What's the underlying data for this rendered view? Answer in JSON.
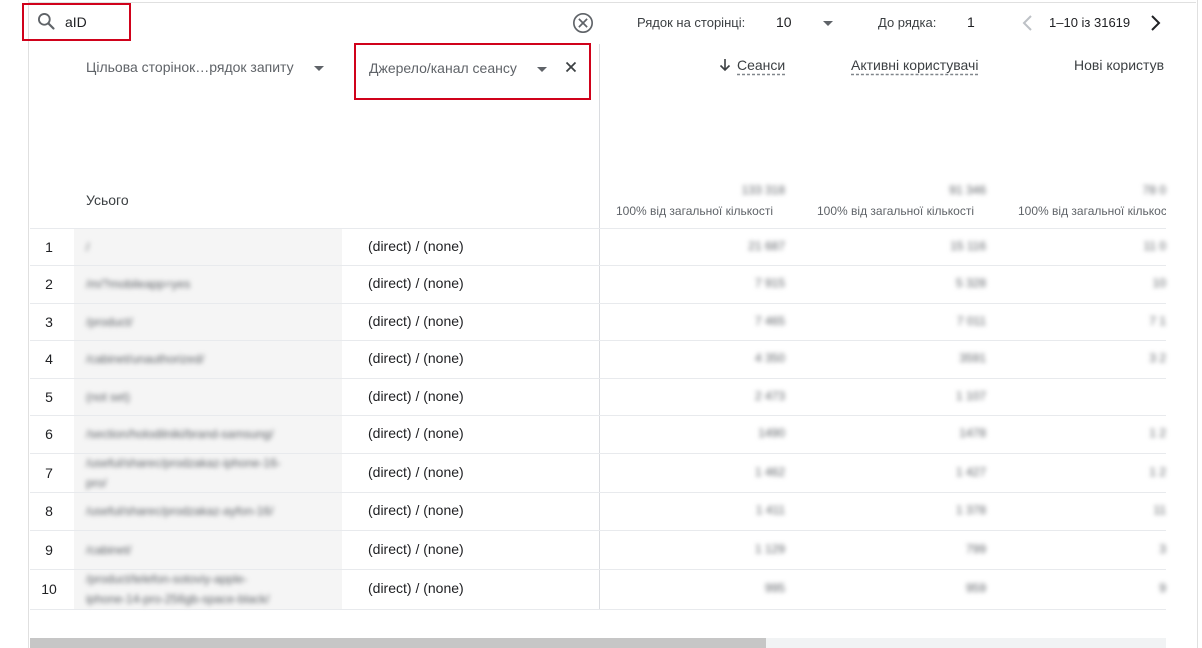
{
  "search": {
    "value": "aID"
  },
  "pagination": {
    "rows_per_page_label": "Рядок на сторінці:",
    "rows_per_page_value": "10",
    "goto_label": "До рядка:",
    "goto_value": "1",
    "range_text": "1–10 із 31619"
  },
  "table": {
    "dimension1_header": "Цільова сторінок…рядок запиту",
    "dimension2_header": "Джерело/канал сеансу",
    "metrics": [
      {
        "label": "Сеанси",
        "total": "133 318",
        "pct": "100% від загальної кількості"
      },
      {
        "label": "Активні користувачі",
        "total": "91 346",
        "pct": "100% від загальної кількості"
      },
      {
        "label": "Нові користув",
        "total": "78 0",
        "pct": "100% від загальної кількос"
      }
    ],
    "totals_label": "Усього",
    "rows": [
      {
        "num": "1",
        "page": "/",
        "page2": "",
        "source": "(direct) / (none)",
        "m1": "21 687",
        "m2": "15 116",
        "m3": "11 0"
      },
      {
        "num": "2",
        "page": "/m/?mobileapp=yes",
        "page2": "",
        "source": "(direct) / (none)",
        "m1": "7 915",
        "m2": "5 328",
        "m3": "10"
      },
      {
        "num": "3",
        "page": "/product/",
        "page2": "",
        "source": "(direct) / (none)",
        "m1": "7 465",
        "m2": "7 011",
        "m3": "7 1"
      },
      {
        "num": "4",
        "page": "/cabinet/unauthorized/",
        "page2": "",
        "source": "(direct) / (none)",
        "m1": "4 350",
        "m2": "3591",
        "m3": "3 2"
      },
      {
        "num": "5",
        "page": "(not set)",
        "page2": "",
        "source": "(direct) / (none)",
        "m1": "2 473",
        "m2": "1 107",
        "m3": ""
      },
      {
        "num": "6",
        "page": "/section/holodilniki/brand-samsung/",
        "page2": "",
        "source": "(direct) / (none)",
        "m1": "1490",
        "m2": "1478",
        "m3": "1 2"
      },
      {
        "num": "7",
        "page": "/useful/sharec/prodzakaz-iphone-16-",
        "page2": "pro/",
        "source": "(direct) / (none)",
        "m1": "1 462",
        "m2": "1 427",
        "m3": "1 2"
      },
      {
        "num": "8",
        "page": "/useful/sharec/prodzakaz-ayfon-16/",
        "page2": "",
        "source": "(direct) / (none)",
        "m1": "1 411",
        "m2": "1 378",
        "m3": "11"
      },
      {
        "num": "9",
        "page": "/cabinet/",
        "page2": "",
        "source": "(direct) / (none)",
        "m1": "1 129",
        "m2": "799",
        "m3": "3"
      },
      {
        "num": "10",
        "page": "/product/telefon-sotoviy-apple-",
        "page2": "iphone-14-pro-256gb-space-black/",
        "source": "(direct) / (none)",
        "m1": "995",
        "m2": "959",
        "m3": "9"
      }
    ]
  },
  "annotation_color": "#d0021b"
}
